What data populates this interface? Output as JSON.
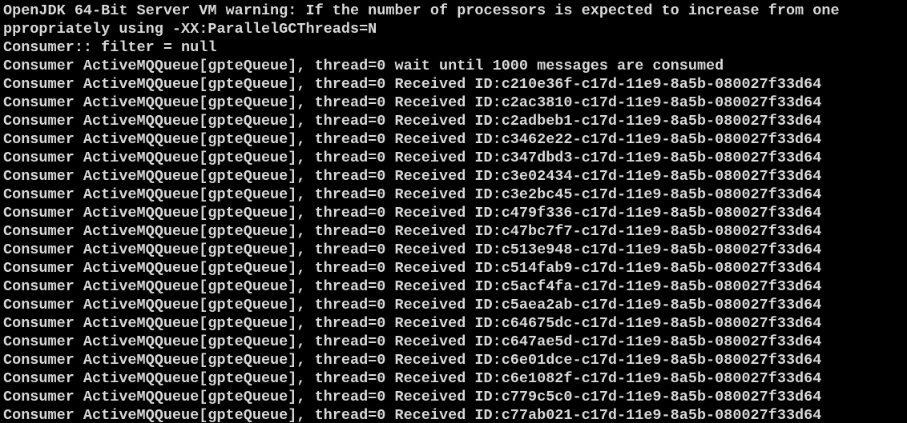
{
  "terminal": {
    "background": "#000000",
    "foreground": "#d8d8d8",
    "lines": [
      "OpenJDK 64-Bit Server VM warning: If the number of processors is expected to increase from one",
      "ppropriately using -XX:ParallelGCThreads=N",
      "Consumer:: filter = null",
      "Consumer ActiveMQQueue[gpteQueue], thread=0 wait until 1000 messages are consumed",
      "Consumer ActiveMQQueue[gpteQueue], thread=0 Received ID:c210e36f-c17d-11e9-8a5b-080027f33d64",
      "Consumer ActiveMQQueue[gpteQueue], thread=0 Received ID:c2ac3810-c17d-11e9-8a5b-080027f33d64",
      "Consumer ActiveMQQueue[gpteQueue], thread=0 Received ID:c2adbeb1-c17d-11e9-8a5b-080027f33d64",
      "Consumer ActiveMQQueue[gpteQueue], thread=0 Received ID:c3462e22-c17d-11e9-8a5b-080027f33d64",
      "Consumer ActiveMQQueue[gpteQueue], thread=0 Received ID:c347dbd3-c17d-11e9-8a5b-080027f33d64",
      "Consumer ActiveMQQueue[gpteQueue], thread=0 Received ID:c3e02434-c17d-11e9-8a5b-080027f33d64",
      "Consumer ActiveMQQueue[gpteQueue], thread=0 Received ID:c3e2bc45-c17d-11e9-8a5b-080027f33d64",
      "Consumer ActiveMQQueue[gpteQueue], thread=0 Received ID:c479f336-c17d-11e9-8a5b-080027f33d64",
      "Consumer ActiveMQQueue[gpteQueue], thread=0 Received ID:c47bc7f7-c17d-11e9-8a5b-080027f33d64",
      "Consumer ActiveMQQueue[gpteQueue], thread=0 Received ID:c513e948-c17d-11e9-8a5b-080027f33d64",
      "Consumer ActiveMQQueue[gpteQueue], thread=0 Received ID:c514fab9-c17d-11e9-8a5b-080027f33d64",
      "Consumer ActiveMQQueue[gpteQueue], thread=0 Received ID:c5acf4fa-c17d-11e9-8a5b-080027f33d64",
      "Consumer ActiveMQQueue[gpteQueue], thread=0 Received ID:c5aea2ab-c17d-11e9-8a5b-080027f33d64",
      "Consumer ActiveMQQueue[gpteQueue], thread=0 Received ID:c64675dc-c17d-11e9-8a5b-080027f33d64",
      "Consumer ActiveMQQueue[gpteQueue], thread=0 Received ID:c647ae5d-c17d-11e9-8a5b-080027f33d64",
      "Consumer ActiveMQQueue[gpteQueue], thread=0 Received ID:c6e01dce-c17d-11e9-8a5b-080027f33d64",
      "Consumer ActiveMQQueue[gpteQueue], thread=0 Received ID:c6e1082f-c17d-11e9-8a5b-080027f33d64",
      "Consumer ActiveMQQueue[gpteQueue], thread=0 Received ID:c779c5c0-c17d-11e9-8a5b-080027f33d64",
      "Consumer ActiveMQQueue[gpteQueue], thread=0 Received ID:c77ab021-c17d-11e9-8a5b-080027f33d64"
    ]
  }
}
